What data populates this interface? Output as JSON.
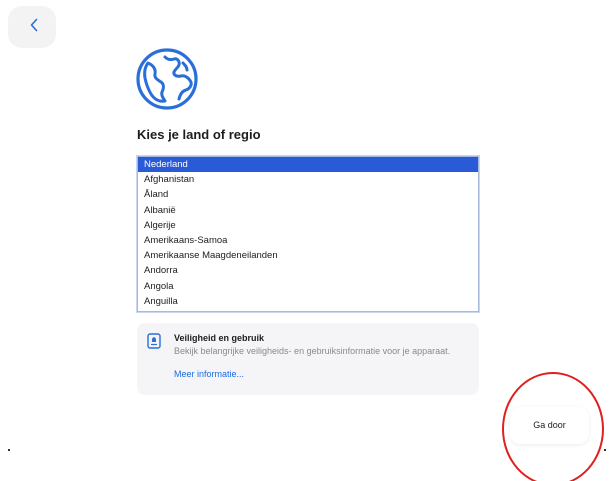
{
  "header": {
    "back_icon": "chevron-left-icon"
  },
  "hero": {
    "icon": "globe-icon",
    "accent_color": "#2a6ed9"
  },
  "page": {
    "title": "Kies je land of regio"
  },
  "country_list": {
    "selected": "Nederland",
    "selection_color": "#2a5bd7",
    "items": [
      "Nederland",
      "Afghanistan",
      "Åland",
      "Albanië",
      "Algerije",
      "Amerikaans-Samoa",
      "Amerikaanse Maagdeneilanden",
      "Andorra",
      "Angola",
      "Anguilla"
    ]
  },
  "info_card": {
    "icon": "privacy-document-icon",
    "title": "Veiligheid en gebruik",
    "body": "Bekijk belangrijke veiligheids- en gebruiksinformatie voor je apparaat.",
    "link": "Meer informatie..."
  },
  "footer": {
    "continue_label": "Ga door",
    "highlight_color": "#e0201e"
  }
}
